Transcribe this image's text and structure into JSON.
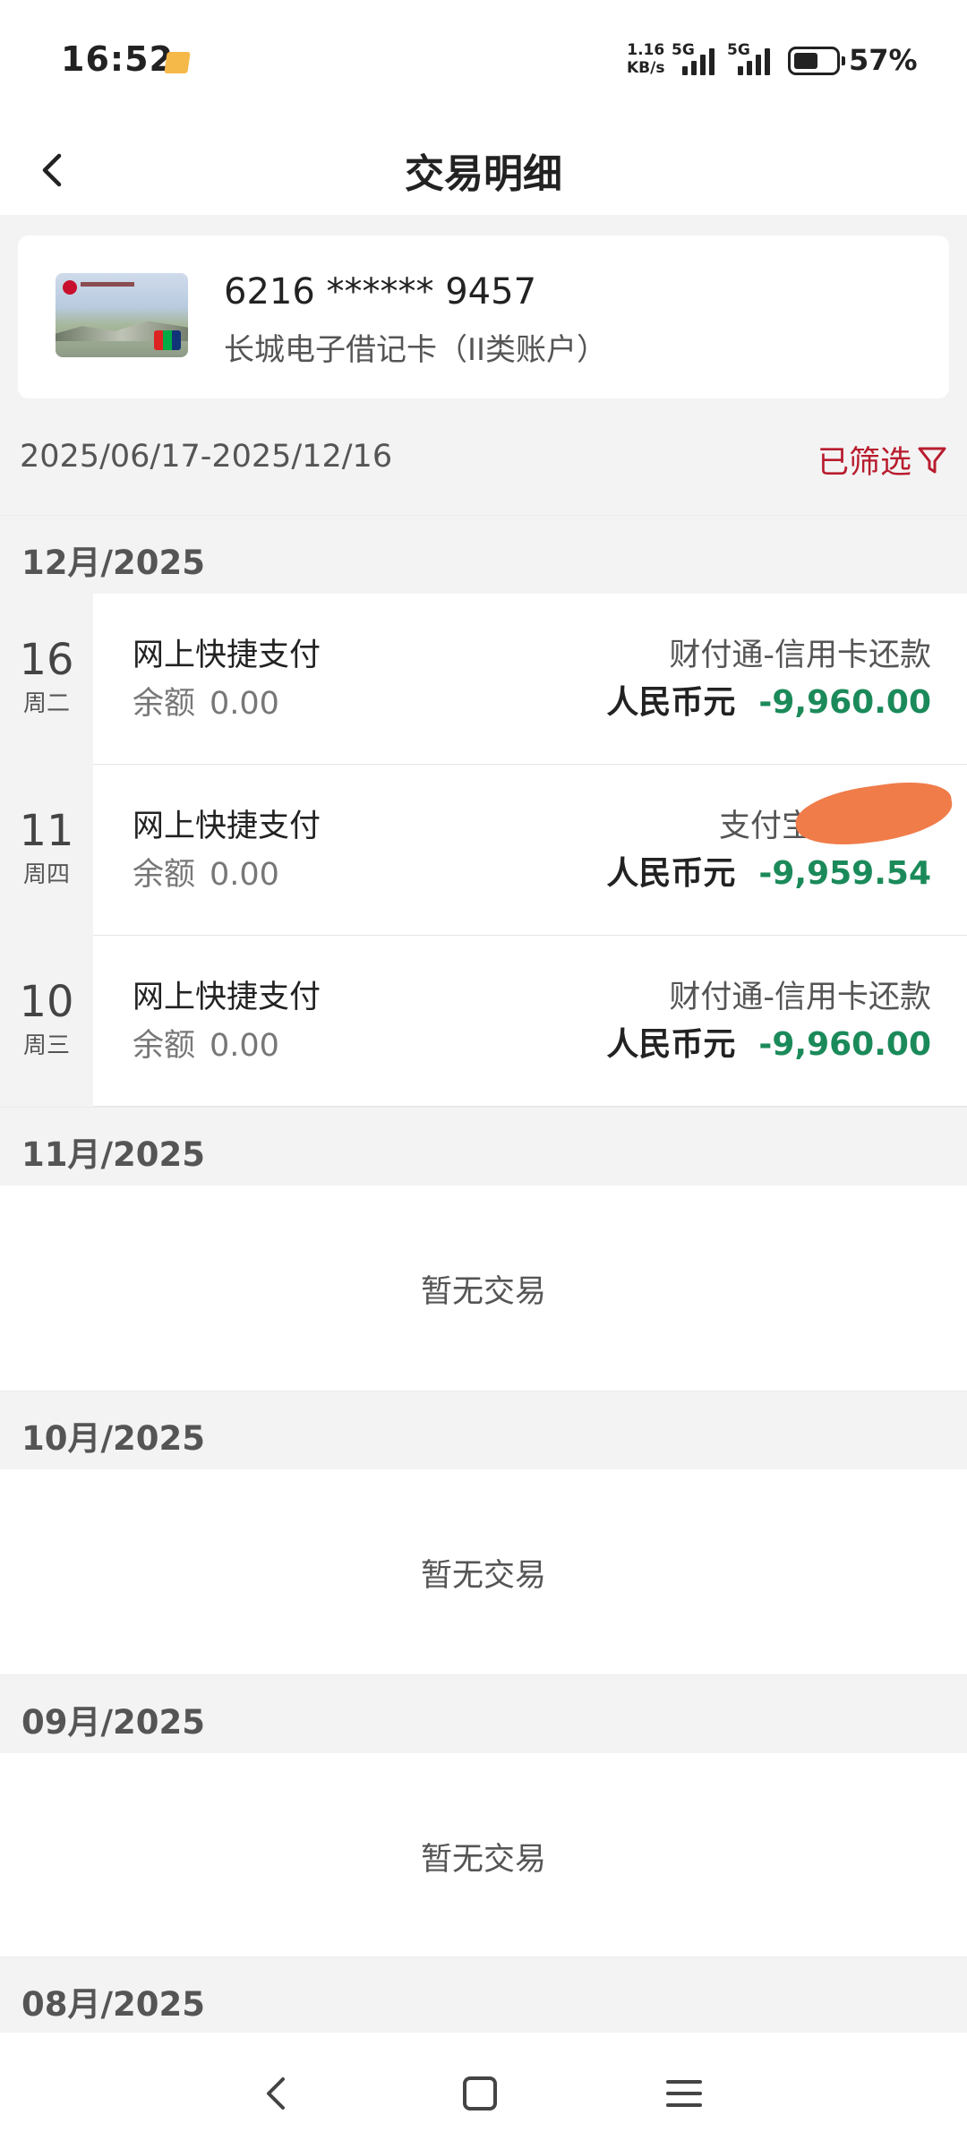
{
  "status_bar": {
    "time": "16:52",
    "net_speed_value": "1.16",
    "net_speed_unit": "KB/s",
    "sim1_label": "5G",
    "sim2_label": "5G",
    "battery_percent": "57%"
  },
  "header": {
    "title": "交易明细"
  },
  "account_card": {
    "card_number": "6216 ****** 9457",
    "card_type": "长城电子借记卡（II类账户）"
  },
  "filter_bar": {
    "date_range": "2025/06/17-2025/12/16",
    "filter_label": "已筛选"
  },
  "months": [
    {
      "label": "12月/2025",
      "transactions": [
        {
          "day": "16",
          "weekday": "周二",
          "title": "网上快捷支付",
          "balance_label": "余额",
          "balance": "0.00",
          "merchant": "财付通-信用卡还款",
          "currency": "人民币元",
          "amount": "-9,960.00"
        },
        {
          "day": "11",
          "weekday": "周四",
          "title": "网上快捷支付",
          "balance_label": "余额",
          "balance": "0.00",
          "merchant": "支付宝",
          "currency": "人民币元",
          "amount": "-9,959.54"
        },
        {
          "day": "10",
          "weekday": "周三",
          "title": "网上快捷支付",
          "balance_label": "余额",
          "balance": "0.00",
          "merchant": "财付通-信用卡还款",
          "currency": "人民币元",
          "amount": "-9,960.00"
        }
      ]
    },
    {
      "label": "11月/2025",
      "empty_text": "暂无交易"
    },
    {
      "label": "10月/2025",
      "empty_text": "暂无交易"
    },
    {
      "label": "09月/2025",
      "empty_text": "暂无交易"
    },
    {
      "label": "08月/2025"
    }
  ],
  "colors": {
    "accent_red": "#b81c2e",
    "amount_green": "#1b8a5a",
    "section_gray": "#f3f3f3",
    "redaction_orange": "#f07c4a"
  },
  "icons": {
    "back": "chevron-left-icon",
    "filter": "funnel-icon",
    "nav_back": "triangle-back-icon",
    "nav_home": "square-home-icon",
    "nav_menu": "three-lines-menu-icon"
  }
}
